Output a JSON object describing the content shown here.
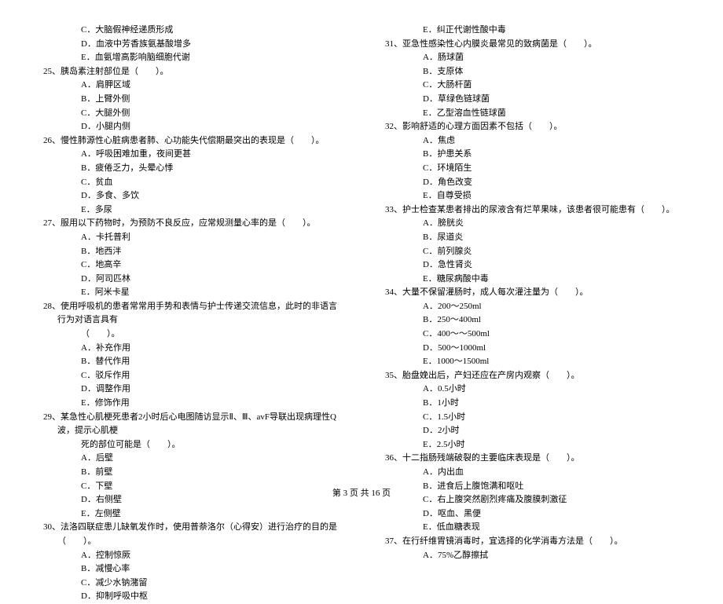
{
  "left": {
    "q24_options": [
      "C．大脑假神经递质形成",
      "D．血液中芳香族氨基酸增多",
      "E．血氨增高影响脑细胞代谢"
    ],
    "q25": "25、胰岛素注射部位是（　　）。",
    "q25_options": [
      "A．肩胛区域",
      "B．上臂外侧",
      "C．大腿外侧",
      "D．小腿内侧"
    ],
    "q26": "26、慢性肺源性心脏病患者肺、心功能失代偿期最突出的表现是（　　）。",
    "q26_options": [
      "A．呼吸困难加重，夜间更甚",
      "B．疲倦乏力，头晕心悸",
      "C．贫血",
      "D．多食、多饮",
      "E．多尿"
    ],
    "q27": "27、服用以下药物时，为预防不良反应，应常规测量心率的是（　　）。",
    "q27_options": [
      "A．卡托普利",
      "B．地西泮",
      "C．地高辛",
      "D．阿司匹林",
      "E．阿米卡星"
    ],
    "q28": "28、使用呼吸机的患者常常用手势和表情与护士传递交流信息，此时的非语言行为对语言具有",
    "q28_sub": "（　　）。",
    "q28_options": [
      "A．补充作用",
      "B．替代作用",
      "C．驳斥作用",
      "D．调整作用",
      "E．修饰作用"
    ],
    "q29": "29、某急性心肌梗死患者2小时后心电图随访显示Ⅱ、Ⅲ、avF导联出现病理性Q波，提示心肌梗",
    "q29_sub": "死的部位可能是（　　）。",
    "q29_options": [
      "A．后壁",
      "B．前壁",
      "C．下壁",
      "D．右侧壁",
      "E．左侧壁"
    ],
    "q30": "30、法洛四联症患儿缺氧发作时，使用普萘洛尔（心得安）进行治疗的目的是（　　）。",
    "q30_options": [
      "A．控制惊厥",
      "B．减慢心率",
      "C．减少水钠潴留",
      "D．抑制呼吸中枢"
    ]
  },
  "right": {
    "q30_e": "E．纠正代谢性酸中毒",
    "q31": "31、亚急性感染性心内膜炎最常见的致病菌是（　　）。",
    "q31_options": [
      "A．肠球菌",
      "B．支原体",
      "C．大肠杆菌",
      "D．草绿色链球菌",
      "E．乙型溶血性链球菌"
    ],
    "q32": "32、影响舒适的心理方面因素不包括（　　）。",
    "q32_options": [
      "A．焦虑",
      "B．护患关系",
      "C．环境陌生",
      "D．角色改变",
      "E．自尊受损"
    ],
    "q33": "33、护士检查某患者排出的尿液含有烂苹果味，该患者很可能患有（　　）。",
    "q33_options": [
      "A．膀胱炎",
      "B．尿道炎",
      "C．前列腺炎",
      "D．急性肾炎",
      "E．糖尿病酸中毒"
    ],
    "q34": "34、大量不保留灌肠时，成人每次灌注量为（　　）。",
    "q34_options": [
      "A．200～250ml",
      "B．250～400ml",
      "C．400～～500ml",
      "D．500～1000ml",
      "E．1000～1500ml"
    ],
    "q35": "35、胎盘娩出后，产妇还应在产房内观察（　　）。",
    "q35_options": [
      "A．0.5小时",
      "B．1小时",
      "C．1.5小时",
      "D．2小时",
      "E．2.5小时"
    ],
    "q36": "36、十二指肠残端破裂的主要临床表现是（　　）。",
    "q36_options": [
      "A．内出血",
      "B．进食后上腹饱满和呕吐",
      "C．右上腹突然剧烈疼痛及腹膜刺激征",
      "D．呕血、黑便",
      "E．低血糖表现"
    ],
    "q37": "37、在行纤维胃镜消毒时，宜选择的化学消毒方法是（　　）。",
    "q37_options": [
      "A．75%乙醇擦拭"
    ]
  },
  "footer": "第 3 页 共 16 页"
}
